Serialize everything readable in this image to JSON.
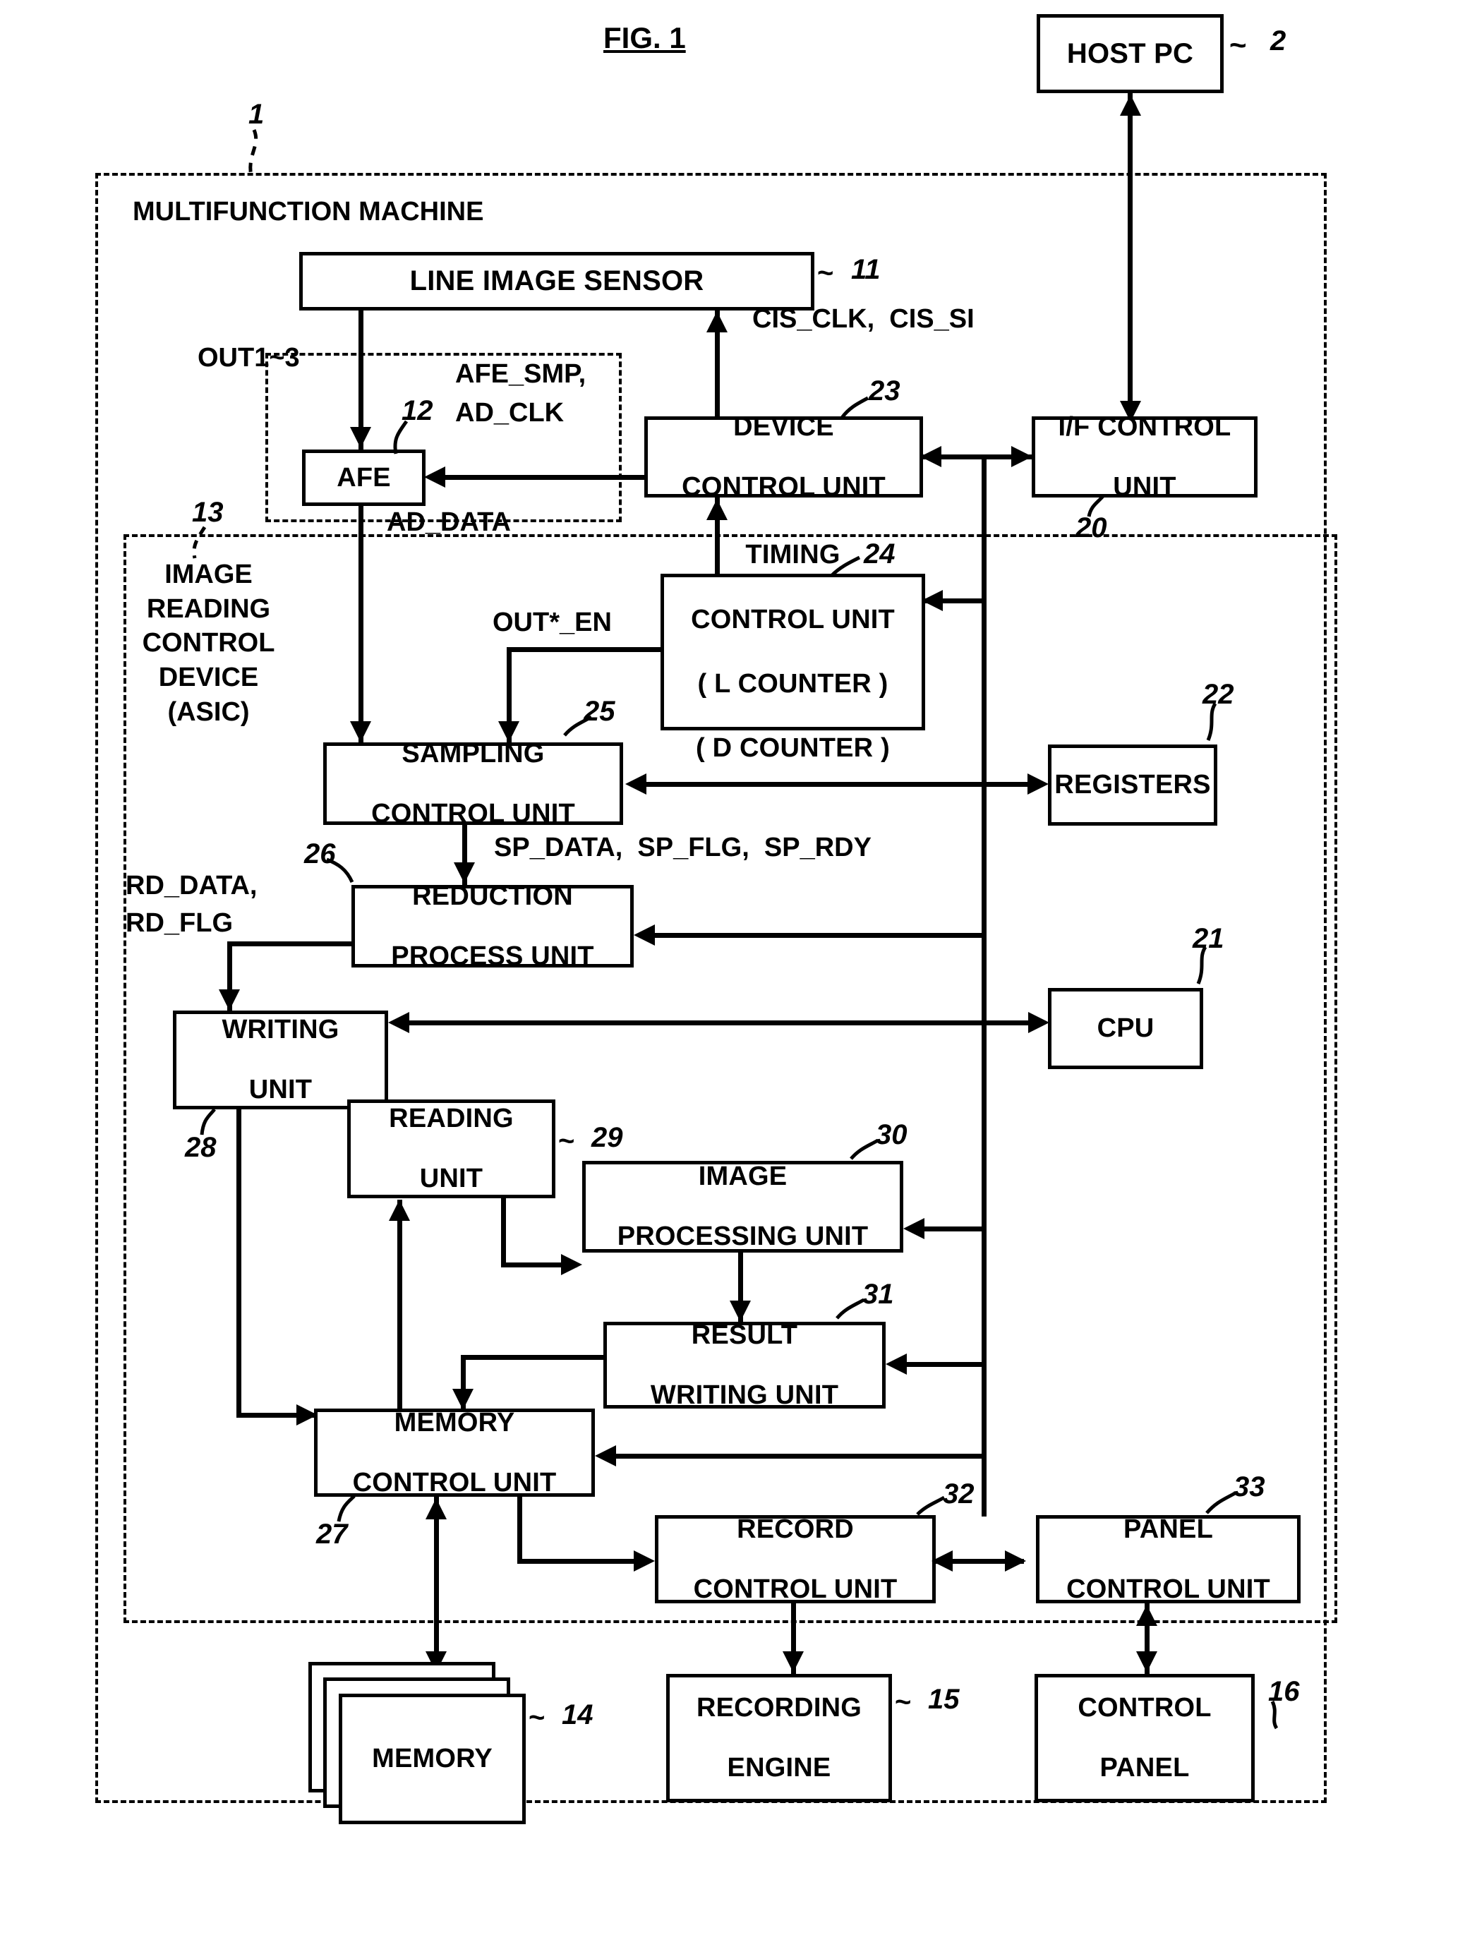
{
  "figure": {
    "title": "FIG. 1"
  },
  "outer": {
    "label": "MULTIFUNCTION MACHINE",
    "ref": "1"
  },
  "asic": {
    "label_lines": [
      "IMAGE",
      "READING",
      "CONTROL",
      "DEVICE",
      "(ASIC)"
    ],
    "ref": "13"
  },
  "blocks": {
    "host_pc": {
      "label": "HOST PC",
      "ref": "2"
    },
    "line_sensor": {
      "label": "LINE IMAGE SENSOR",
      "ref": "11"
    },
    "afe": {
      "label": "AFE",
      "ref": "12"
    },
    "device_ctrl": {
      "label_lines": [
        "DEVICE",
        "CONTROL UNIT"
      ],
      "ref": "23"
    },
    "if_ctrl": {
      "label_lines": [
        "I/F CONTROL",
        "UNIT"
      ],
      "ref": "20"
    },
    "timing_ctrl": {
      "label_lines": [
        "TIMING",
        "CONTROL UNIT",
        "( L COUNTER )",
        "( D COUNTER )"
      ],
      "ref": "24"
    },
    "sampling_ctrl": {
      "label_lines": [
        "SAMPLING",
        "CONTROL UNIT"
      ],
      "ref": "25"
    },
    "registers": {
      "label": "REGISTERS",
      "ref": "22"
    },
    "reduction": {
      "label_lines": [
        "REDUCTION",
        "PROCESS UNIT"
      ],
      "ref": "26"
    },
    "cpu": {
      "label": "CPU",
      "ref": "21"
    },
    "writing": {
      "label_lines": [
        "WRITING",
        "UNIT"
      ],
      "ref": "28"
    },
    "reading": {
      "label_lines": [
        "READING",
        "UNIT"
      ],
      "ref": "29"
    },
    "image_proc": {
      "label_lines": [
        "IMAGE",
        "PROCESSING UNIT"
      ],
      "ref": "30"
    },
    "result_writing": {
      "label_lines": [
        "RESULT",
        "WRITING UNIT"
      ],
      "ref": "31"
    },
    "memory_ctrl": {
      "label_lines": [
        "MEMORY",
        "CONTROL UNIT"
      ],
      "ref": "27"
    },
    "record_ctrl": {
      "label_lines": [
        "RECORD",
        "CONTROL UNIT"
      ],
      "ref": "32"
    },
    "panel_ctrl": {
      "label_lines": [
        "PANEL",
        "CONTROL UNIT"
      ],
      "ref": "33"
    },
    "memory": {
      "label": "MEMORY",
      "ref": "14"
    },
    "recording_eng": {
      "label_lines": [
        "RECORDING",
        "ENGINE"
      ],
      "ref": "15"
    },
    "control_panel": {
      "label_lines": [
        "CONTROL",
        "PANEL"
      ],
      "ref": "16"
    }
  },
  "signals": {
    "out1_3": "OUT1~3",
    "afe_smp": "AFE_SMP,",
    "ad_clk": "AD_CLK",
    "ad_data": "AD_DATA",
    "cis": "CIS_CLK,  CIS_SI",
    "out_en": "OUT*_EN",
    "sp": "SP_DATA,  SP_FLG,  SP_RDY",
    "rd_data": "RD_DATA,",
    "rd_flg": "RD_FLG"
  },
  "chart_data": {
    "type": "diagram",
    "title": "FIG. 1",
    "nodes": [
      {
        "id": "2",
        "label": "HOST PC"
      },
      {
        "id": "11",
        "label": "LINE IMAGE SENSOR"
      },
      {
        "id": "12",
        "label": "AFE"
      },
      {
        "id": "20",
        "label": "I/F CONTROL UNIT"
      },
      {
        "id": "21",
        "label": "CPU"
      },
      {
        "id": "22",
        "label": "REGISTERS"
      },
      {
        "id": "23",
        "label": "DEVICE CONTROL UNIT"
      },
      {
        "id": "24",
        "label": "TIMING CONTROL UNIT (L COUNTER, D COUNTER)"
      },
      {
        "id": "25",
        "label": "SAMPLING CONTROL UNIT"
      },
      {
        "id": "26",
        "label": "REDUCTION PROCESS UNIT"
      },
      {
        "id": "27",
        "label": "MEMORY CONTROL UNIT"
      },
      {
        "id": "28",
        "label": "WRITING UNIT"
      },
      {
        "id": "29",
        "label": "READING UNIT"
      },
      {
        "id": "30",
        "label": "IMAGE PROCESSING UNIT"
      },
      {
        "id": "31",
        "label": "RESULT WRITING UNIT"
      },
      {
        "id": "32",
        "label": "RECORD CONTROL UNIT"
      },
      {
        "id": "33",
        "label": "PANEL CONTROL UNIT"
      },
      {
        "id": "14",
        "label": "MEMORY"
      },
      {
        "id": "15",
        "label": "RECORDING ENGINE"
      },
      {
        "id": "16",
        "label": "CONTROL PANEL"
      },
      {
        "id": "1",
        "label": "MULTIFUNCTION MACHINE"
      },
      {
        "id": "13",
        "label": "IMAGE READING CONTROL DEVICE (ASIC)"
      }
    ],
    "edges": [
      {
        "from": "11",
        "to": "12",
        "label": "OUT1~3",
        "dir": "one"
      },
      {
        "from": "23",
        "to": "12",
        "label": "AFE_SMP, AD_CLK",
        "dir": "one"
      },
      {
        "from": "12",
        "to": "25",
        "label": "AD_DATA",
        "dir": "one"
      },
      {
        "from": "23",
        "to": "11",
        "label": "CIS_CLK, CIS_SI",
        "dir": "one"
      },
      {
        "from": "20",
        "to": "2",
        "label": "",
        "dir": "both"
      },
      {
        "from": "23",
        "to": "20",
        "label": "",
        "dir": "both"
      },
      {
        "from": "24",
        "to": "23",
        "label": "",
        "dir": "one"
      },
      {
        "from": "24",
        "to": "25",
        "label": "OUT*_EN",
        "dir": "one"
      },
      {
        "from": "25",
        "to": "26",
        "label": "SP_DATA, SP_FLG, SP_RDY",
        "dir": "one"
      },
      {
        "from": "25",
        "to": "22",
        "label": "",
        "dir": "both"
      },
      {
        "from": "26",
        "to": "28",
        "label": "RD_DATA, RD_FLG",
        "dir": "one"
      },
      {
        "from": "28",
        "to": "21",
        "label": "",
        "dir": "both"
      },
      {
        "from": "28",
        "to": "27",
        "label": "",
        "dir": "one"
      },
      {
        "from": "29",
        "to": "30",
        "label": "",
        "dir": "one"
      },
      {
        "from": "30",
        "to": "31",
        "label": "",
        "dir": "one"
      },
      {
        "from": "31",
        "to": "27",
        "label": "",
        "dir": "one"
      },
      {
        "from": "27",
        "to": "29",
        "label": "",
        "dir": "one"
      },
      {
        "from": "27",
        "to": "32",
        "label": "",
        "dir": "one"
      },
      {
        "from": "32",
        "to": "33",
        "label": "",
        "dir": "both"
      },
      {
        "from": "27",
        "to": "14",
        "label": "",
        "dir": "both"
      },
      {
        "from": "32",
        "to": "15",
        "label": "",
        "dir": "one"
      },
      {
        "from": "33",
        "to": "16",
        "label": "",
        "dir": "both"
      }
    ]
  }
}
